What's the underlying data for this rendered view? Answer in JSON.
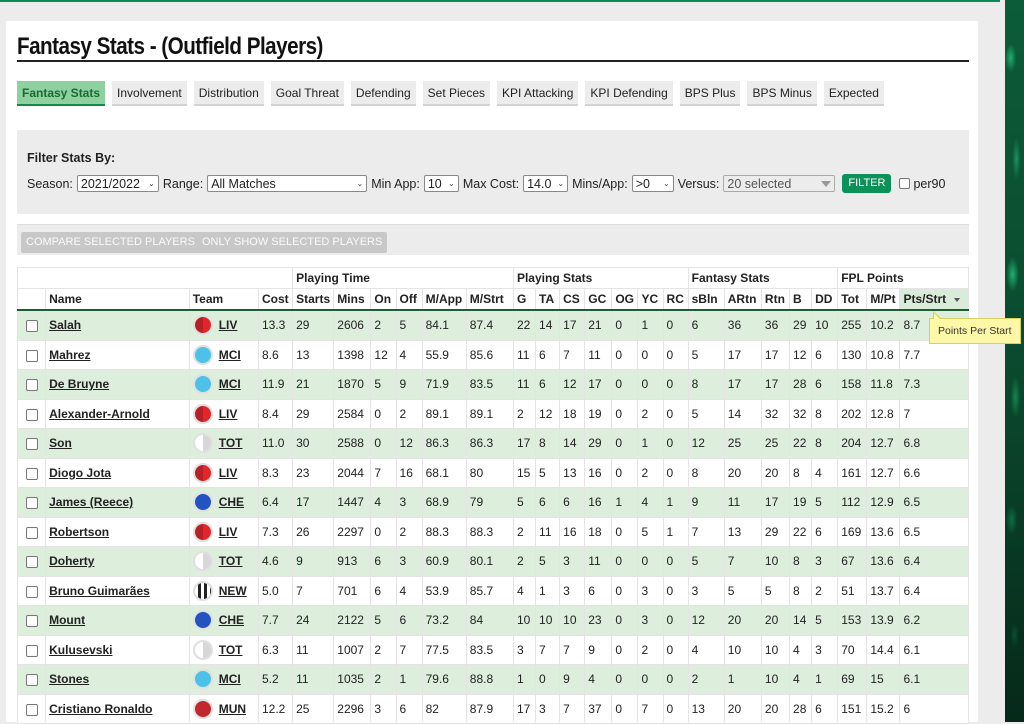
{
  "page": {
    "title": "Fantasy Stats - (Outfield Players)"
  },
  "colors": {
    "accent": "#0c9159",
    "active_tab_bg": "#8ed19e",
    "row_alt_bg": "#ddeedd",
    "tooltip_bg": "#fdf8a7"
  },
  "tabs": [
    {
      "label": "Fantasy Stats",
      "active": true
    },
    {
      "label": "Involvement",
      "active": false
    },
    {
      "label": "Distribution",
      "active": false
    },
    {
      "label": "Goal Threat",
      "active": false
    },
    {
      "label": "Defending",
      "active": false
    },
    {
      "label": "Set Pieces",
      "active": false
    },
    {
      "label": "KPI Attacking",
      "active": false
    },
    {
      "label": "KPI Defending",
      "active": false
    },
    {
      "label": "BPS Plus",
      "active": false
    },
    {
      "label": "BPS Minus",
      "active": false
    },
    {
      "label": "Expected",
      "active": false
    }
  ],
  "filters": {
    "heading": "Filter Stats By:",
    "season_label": "Season:",
    "season_value": "2021/2022",
    "range_label": "Range:",
    "range_value": "All Matches",
    "min_app_label": "Min App:",
    "min_app_value": "10",
    "max_cost_label": "Max Cost:",
    "max_cost_value": "14.0",
    "mins_app_label": "Mins/App:",
    "mins_app_value": ">0",
    "versus_label": "Versus:",
    "versus_value": "20 selected",
    "filter_button": "FILTER",
    "per90_label": "per90",
    "per90_checked": false
  },
  "actions": {
    "compare": "COMPARE SELECTED PLAYERS",
    "only_show": "ONLY SHOW SELECTED PLAYERS"
  },
  "table": {
    "groups": [
      "Playing Time",
      "Playing Stats",
      "Fantasy Stats",
      "FPL Points"
    ],
    "columns": [
      "Name",
      "Team",
      "Cost",
      "Starts",
      "Mins",
      "On",
      "Off",
      "M/App",
      "M/Strt",
      "G",
      "TA",
      "CS",
      "GC",
      "OG",
      "YC",
      "RC",
      "sBln",
      "ARtn",
      "Rtn",
      "B",
      "DD",
      "Tot",
      "M/Pt",
      "Pts/Strt"
    ],
    "sorted_column": "Pts/Strt",
    "sort_direction": "desc",
    "rows": [
      {
        "name": "Salah",
        "team": "LIV",
        "stats": [
          "13.3",
          "29",
          "2606",
          "2",
          "5",
          "84.1",
          "87.4",
          "22",
          "14",
          "17",
          "21",
          "0",
          "1",
          "0",
          "6",
          "36",
          "36",
          "29",
          "10",
          "255",
          "10.2",
          "8.7"
        ]
      },
      {
        "name": "Mahrez",
        "team": "MCI",
        "stats": [
          "8.6",
          "13",
          "1398",
          "12",
          "4",
          "55.9",
          "85.6",
          "11",
          "6",
          "7",
          "11",
          "0",
          "0",
          "0",
          "5",
          "17",
          "17",
          "12",
          "6",
          "130",
          "10.8",
          "7.7"
        ]
      },
      {
        "name": "De Bruyne",
        "team": "MCI",
        "stats": [
          "11.9",
          "21",
          "1870",
          "5",
          "9",
          "71.9",
          "83.5",
          "11",
          "6",
          "12",
          "17",
          "0",
          "0",
          "0",
          "8",
          "17",
          "17",
          "28",
          "6",
          "158",
          "11.8",
          "7.3"
        ]
      },
      {
        "name": "Alexander-Arnold",
        "team": "LIV",
        "stats": [
          "8.4",
          "29",
          "2584",
          "0",
          "2",
          "89.1",
          "89.1",
          "2",
          "12",
          "18",
          "19",
          "0",
          "2",
          "0",
          "5",
          "14",
          "32",
          "32",
          "8",
          "202",
          "12.8",
          "7"
        ]
      },
      {
        "name": "Son",
        "team": "TOT",
        "stats": [
          "11.0",
          "30",
          "2588",
          "0",
          "12",
          "86.3",
          "86.3",
          "17",
          "8",
          "14",
          "29",
          "0",
          "1",
          "0",
          "12",
          "25",
          "25",
          "22",
          "8",
          "204",
          "12.7",
          "6.8"
        ]
      },
      {
        "name": "Diogo Jota",
        "team": "LIV",
        "stats": [
          "8.3",
          "23",
          "2044",
          "7",
          "16",
          "68.1",
          "80",
          "15",
          "5",
          "13",
          "16",
          "0",
          "2",
          "0",
          "8",
          "20",
          "20",
          "8",
          "4",
          "161",
          "12.7",
          "6.6"
        ]
      },
      {
        "name": "James (Reece)",
        "team": "CHE",
        "stats": [
          "6.4",
          "17",
          "1447",
          "4",
          "3",
          "68.9",
          "79",
          "5",
          "6",
          "6",
          "16",
          "1",
          "4",
          "1",
          "9",
          "11",
          "17",
          "19",
          "5",
          "112",
          "12.9",
          "6.5"
        ]
      },
      {
        "name": "Robertson",
        "team": "LIV",
        "stats": [
          "7.3",
          "26",
          "2297",
          "0",
          "2",
          "88.3",
          "88.3",
          "2",
          "11",
          "16",
          "18",
          "0",
          "5",
          "1",
          "7",
          "13",
          "29",
          "22",
          "6",
          "169",
          "13.6",
          "6.5"
        ]
      },
      {
        "name": "Doherty",
        "team": "TOT",
        "stats": [
          "4.6",
          "9",
          "913",
          "6",
          "3",
          "60.9",
          "80.1",
          "2",
          "5",
          "3",
          "11",
          "0",
          "0",
          "0",
          "5",
          "7",
          "10",
          "8",
          "3",
          "67",
          "13.6",
          "6.4"
        ]
      },
      {
        "name": "Bruno Guimarães",
        "team": "NEW",
        "stats": [
          "5.0",
          "7",
          "701",
          "6",
          "4",
          "53.9",
          "85.7",
          "4",
          "1",
          "3",
          "6",
          "0",
          "3",
          "0",
          "3",
          "5",
          "5",
          "8",
          "2",
          "51",
          "13.7",
          "6.4"
        ]
      },
      {
        "name": "Mount",
        "team": "CHE",
        "stats": [
          "7.7",
          "24",
          "2122",
          "5",
          "6",
          "73.2",
          "84",
          "10",
          "10",
          "10",
          "23",
          "0",
          "3",
          "0",
          "12",
          "20",
          "20",
          "14",
          "5",
          "153",
          "13.9",
          "6.2"
        ]
      },
      {
        "name": "Kulusevski",
        "team": "TOT",
        "stats": [
          "6.3",
          "11",
          "1007",
          "2",
          "7",
          "77.5",
          "83.5",
          "3",
          "7",
          "7",
          "9",
          "0",
          "2",
          "0",
          "4",
          "10",
          "10",
          "4",
          "3",
          "70",
          "14.4",
          "6.1"
        ]
      },
      {
        "name": "Stones",
        "team": "MCI",
        "stats": [
          "5.2",
          "11",
          "1035",
          "2",
          "1",
          "79.6",
          "88.8",
          "1",
          "0",
          "9",
          "4",
          "0",
          "0",
          "0",
          "2",
          "1",
          "10",
          "4",
          "1",
          "69",
          "15",
          "6.1"
        ]
      },
      {
        "name": "Cristiano Ronaldo",
        "team": "MUN",
        "stats": [
          "12.2",
          "25",
          "2296",
          "3",
          "6",
          "82",
          "87.9",
          "17",
          "3",
          "7",
          "37",
          "0",
          "7",
          "0",
          "13",
          "20",
          "20",
          "28",
          "6",
          "151",
          "15.2",
          "6"
        ]
      }
    ]
  },
  "tooltip": {
    "text": "Points Per Start"
  }
}
